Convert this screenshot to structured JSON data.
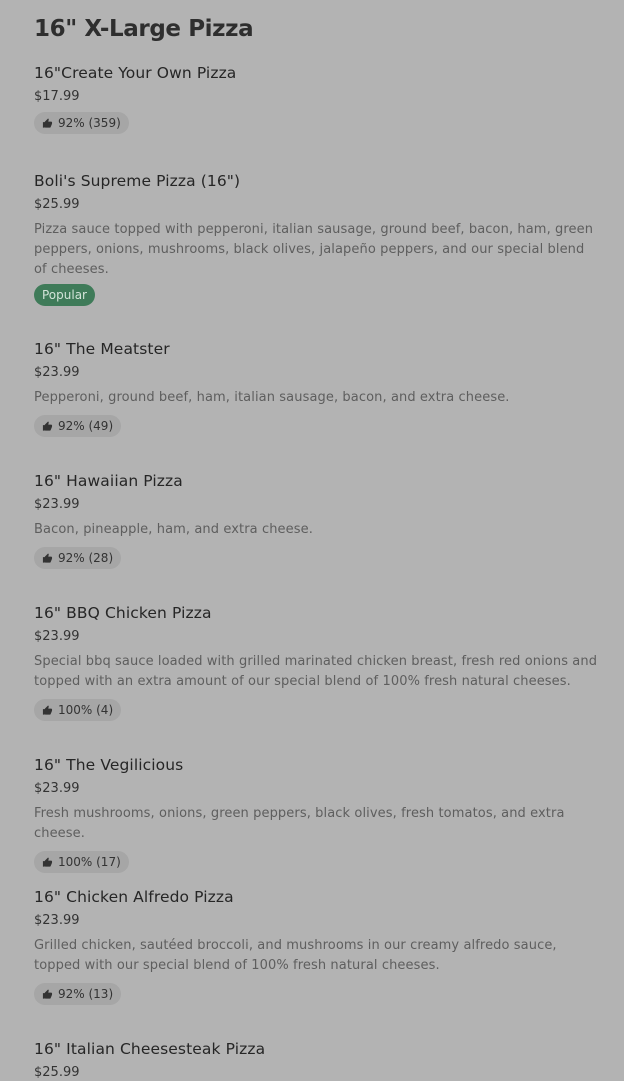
{
  "section": {
    "title": "16\" X-Large Pizza"
  },
  "items": [
    {
      "name": "16\"Create Your Own Pizza",
      "price": "$17.99",
      "rating": "92% (359)"
    },
    {
      "name": "Boli's Supreme Pizza (16\")",
      "price": "$25.99",
      "description": "Pizza sauce topped with pepperoni, italian sausage, ground beef, bacon, ham, green peppers, onions, mushrooms, black olives, jalapeño peppers, and our special blend of cheeses.",
      "badge": "Popular"
    },
    {
      "name": "16\" The Meatster",
      "price": "$23.99",
      "description": "Pepperoni, ground beef, ham, italian sausage, bacon, and extra cheese.",
      "rating": "92% (49)"
    },
    {
      "name": "16\" Hawaiian Pizza",
      "price": "$23.99",
      "description": "Bacon, pineapple, ham, and extra cheese.",
      "rating": "92% (28)"
    },
    {
      "name": "16\" BBQ Chicken Pizza",
      "price": "$23.99",
      "description": "Special bbq sauce loaded with grilled marinated chicken breast, fresh red onions and topped with an extra amount of our special blend of 100% fresh natural cheeses.",
      "rating": "100% (4)"
    },
    {
      "name": "16\" The Vegilicious",
      "price": "$23.99",
      "description": "Fresh mushrooms, onions, green peppers, black olives, fresh tomatos, and extra cheese.",
      "rating": "100% (17)"
    },
    {
      "name": "16\" Chicken Alfredo Pizza",
      "price": "$23.99",
      "description": "Grilled chicken, sautéed broccoli, and mushrooms in our creamy alfredo sauce, topped with our special blend of 100% fresh natural cheeses.",
      "rating": "92% (13)"
    },
    {
      "name": "16\" Italian Cheesesteak Pizza",
      "price": "$25.99"
    }
  ],
  "icons": {
    "rating": "thumbs-up-icon"
  },
  "colors": {
    "background": "#b3b3b3",
    "badge": "#3f7b59",
    "rating_pill": "#a6a6a6"
  }
}
